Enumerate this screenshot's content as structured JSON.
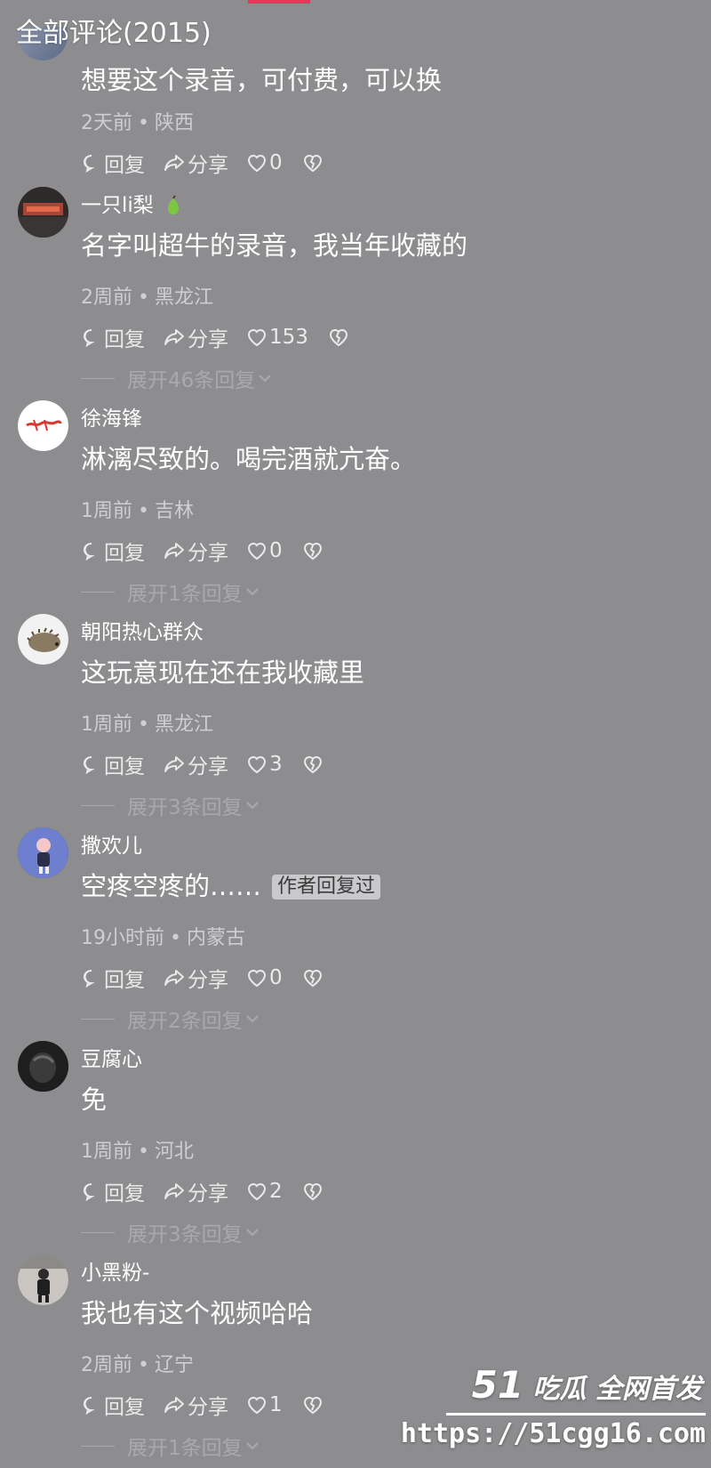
{
  "header": {
    "title": "全部评论(2015)"
  },
  "first_comment": {
    "text": "想要这个录音，可付费，可以换",
    "time": "2天前",
    "location": "陕西",
    "reply_label": "回复",
    "share_label": "分享",
    "likes": "0"
  },
  "comments": [
    {
      "username": "一只li梨",
      "text": "名字叫超牛的录音，我当年收藏的",
      "time": "2周前",
      "location": "黑龙江",
      "reply_label": "回复",
      "share_label": "分享",
      "likes": "153",
      "expand": "展开46条回复"
    },
    {
      "username": "徐海锋",
      "text": "淋漓尽致的。喝完酒就亢奋。",
      "time": "1周前",
      "location": "吉林",
      "reply_label": "回复",
      "share_label": "分享",
      "likes": "0",
      "expand": "展开1条回复"
    },
    {
      "username": "朝阳热心群众",
      "text": "这玩意现在还在我收藏里",
      "time": "1周前",
      "location": "黑龙江",
      "reply_label": "回复",
      "share_label": "分享",
      "likes": "3",
      "expand": "展开3条回复"
    },
    {
      "username": "撒欢儿",
      "text": "空疼空疼的……",
      "badge": "作者回复过",
      "time": "19小时前",
      "location": "内蒙古",
      "reply_label": "回复",
      "share_label": "分享",
      "likes": "0",
      "expand": "展开2条回复"
    },
    {
      "username": "豆腐心",
      "text": "免",
      "time": "1周前",
      "location": "河北",
      "reply_label": "回复",
      "share_label": "分享",
      "likes": "2",
      "expand": "展开3条回复"
    },
    {
      "username": "小黑粉-",
      "text": "我也有这个视频哈哈",
      "time": "2周前",
      "location": "辽宁",
      "reply_label": "回复",
      "share_label": "分享",
      "likes": "1",
      "expand": "展开1条回复"
    }
  ],
  "watermark": {
    "logo_number": "51",
    "logo_text": "吃瓜 全网首发",
    "url": "https://51cgg16.com"
  },
  "colors": {
    "background": "#8d8d8f",
    "accent": "#e8365a",
    "text": "#ffffff",
    "meta": "#cfcfd1",
    "expand": "#a9a9ac"
  }
}
